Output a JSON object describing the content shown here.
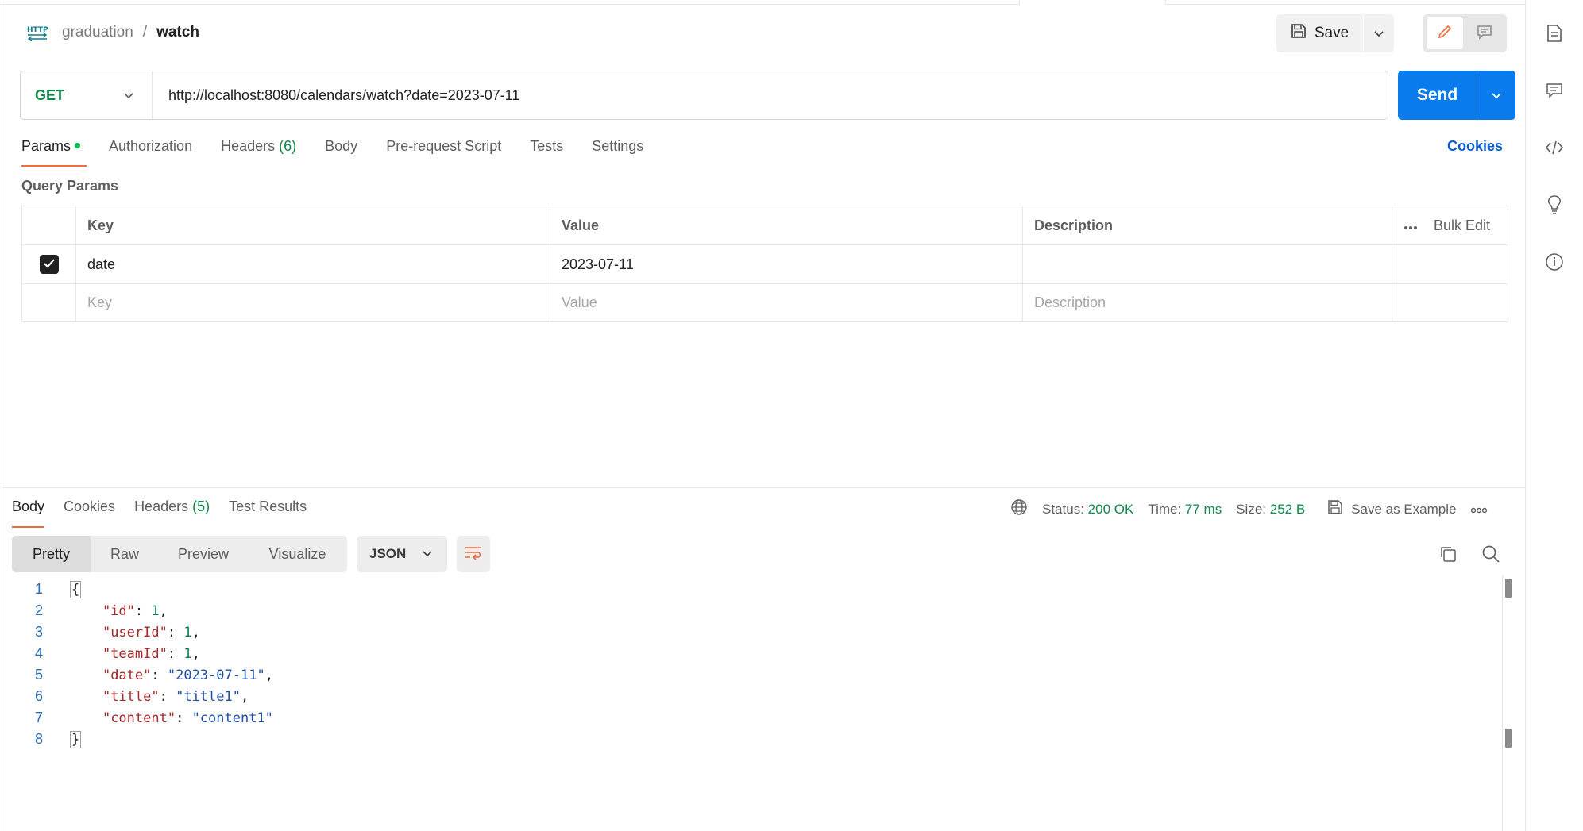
{
  "header": {
    "collection": "graduation",
    "separator": "/",
    "request_name": "watch",
    "http_badge": "HTTP",
    "save_label": "Save"
  },
  "request": {
    "method": "GET",
    "url": "http://localhost:8080/calendars/watch?date=2023-07-11",
    "send_label": "Send"
  },
  "request_tabs": [
    {
      "label": "Params",
      "active": true
    },
    {
      "label": "Authorization"
    },
    {
      "label": "Headers",
      "count": "(6)"
    },
    {
      "label": "Body"
    },
    {
      "label": "Pre-request Script"
    },
    {
      "label": "Tests"
    },
    {
      "label": "Settings"
    }
  ],
  "cookies_link": "Cookies",
  "query_params": {
    "title": "Query Params",
    "headers": {
      "key": "Key",
      "value": "Value",
      "description": "Description",
      "bulk_edit": "Bulk Edit"
    },
    "rows": [
      {
        "checked": true,
        "key": "date",
        "value": "2023-07-11",
        "description": ""
      }
    ],
    "placeholders": {
      "key": "Key",
      "value": "Value",
      "description": "Description"
    }
  },
  "response_tabs": [
    {
      "label": "Body",
      "active": true
    },
    {
      "label": "Cookies"
    },
    {
      "label": "Headers",
      "count": "(5)"
    },
    {
      "label": "Test Results"
    }
  ],
  "response_status": {
    "status_label": "Status:",
    "status_value": "200 OK",
    "time_label": "Time:",
    "time_value": "77 ms",
    "size_label": "Size:",
    "size_value": "252 B",
    "save_example": "Save as Example"
  },
  "view_modes": [
    "Pretty",
    "Raw",
    "Preview",
    "Visualize"
  ],
  "format": "JSON",
  "response_body": {
    "line_numbers": [
      "1",
      "2",
      "3",
      "4",
      "5",
      "6",
      "7",
      "8"
    ],
    "open": "{",
    "close": "}",
    "fields": [
      {
        "key": "\"id\"",
        "value": "1",
        "type": "number"
      },
      {
        "key": "\"userId\"",
        "value": "1",
        "type": "number"
      },
      {
        "key": "\"teamId\"",
        "value": "1",
        "type": "number"
      },
      {
        "key": "\"date\"",
        "value": "\"2023-07-11\"",
        "type": "string"
      },
      {
        "key": "\"title\"",
        "value": "\"title1\"",
        "type": "string"
      },
      {
        "key": "\"content\"",
        "value": "\"content1\"",
        "type": "string"
      }
    ]
  },
  "colors": {
    "accent": "#f26b3a",
    "send_blue": "#097bed",
    "get_green": "#0f8a4a",
    "link_blue": "#0a5ec9"
  }
}
